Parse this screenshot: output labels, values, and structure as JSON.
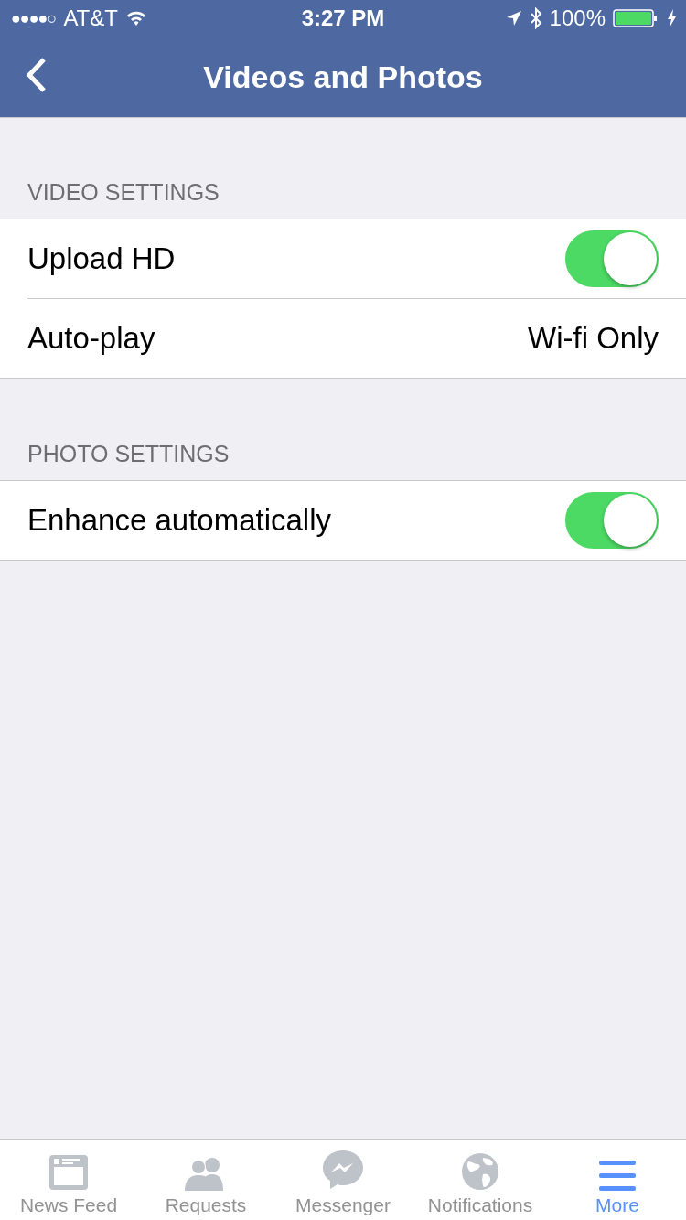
{
  "status_bar": {
    "signal_dots": "●●●●○",
    "carrier": "AT&T",
    "time": "3:27 PM",
    "battery": "100%"
  },
  "nav": {
    "title": "Videos and Photos"
  },
  "sections": [
    {
      "header": "VIDEO SETTINGS",
      "rows": [
        {
          "kind": "toggle",
          "label": "Upload HD",
          "on": true
        },
        {
          "kind": "value",
          "label": "Auto-play",
          "value": "Wi-fi Only"
        }
      ]
    },
    {
      "header": "PHOTO SETTINGS",
      "rows": [
        {
          "kind": "toggle",
          "label": "Enhance automatically",
          "on": true
        }
      ]
    }
  ],
  "tabs": [
    {
      "kind": "feed",
      "label": "News Feed",
      "selected": false
    },
    {
      "kind": "people",
      "label": "Requests",
      "selected": false
    },
    {
      "kind": "chat",
      "label": "Messenger",
      "selected": false
    },
    {
      "kind": "globe",
      "label": "Notifications",
      "selected": false
    },
    {
      "kind": "menu",
      "label": "More",
      "selected": true
    }
  ]
}
